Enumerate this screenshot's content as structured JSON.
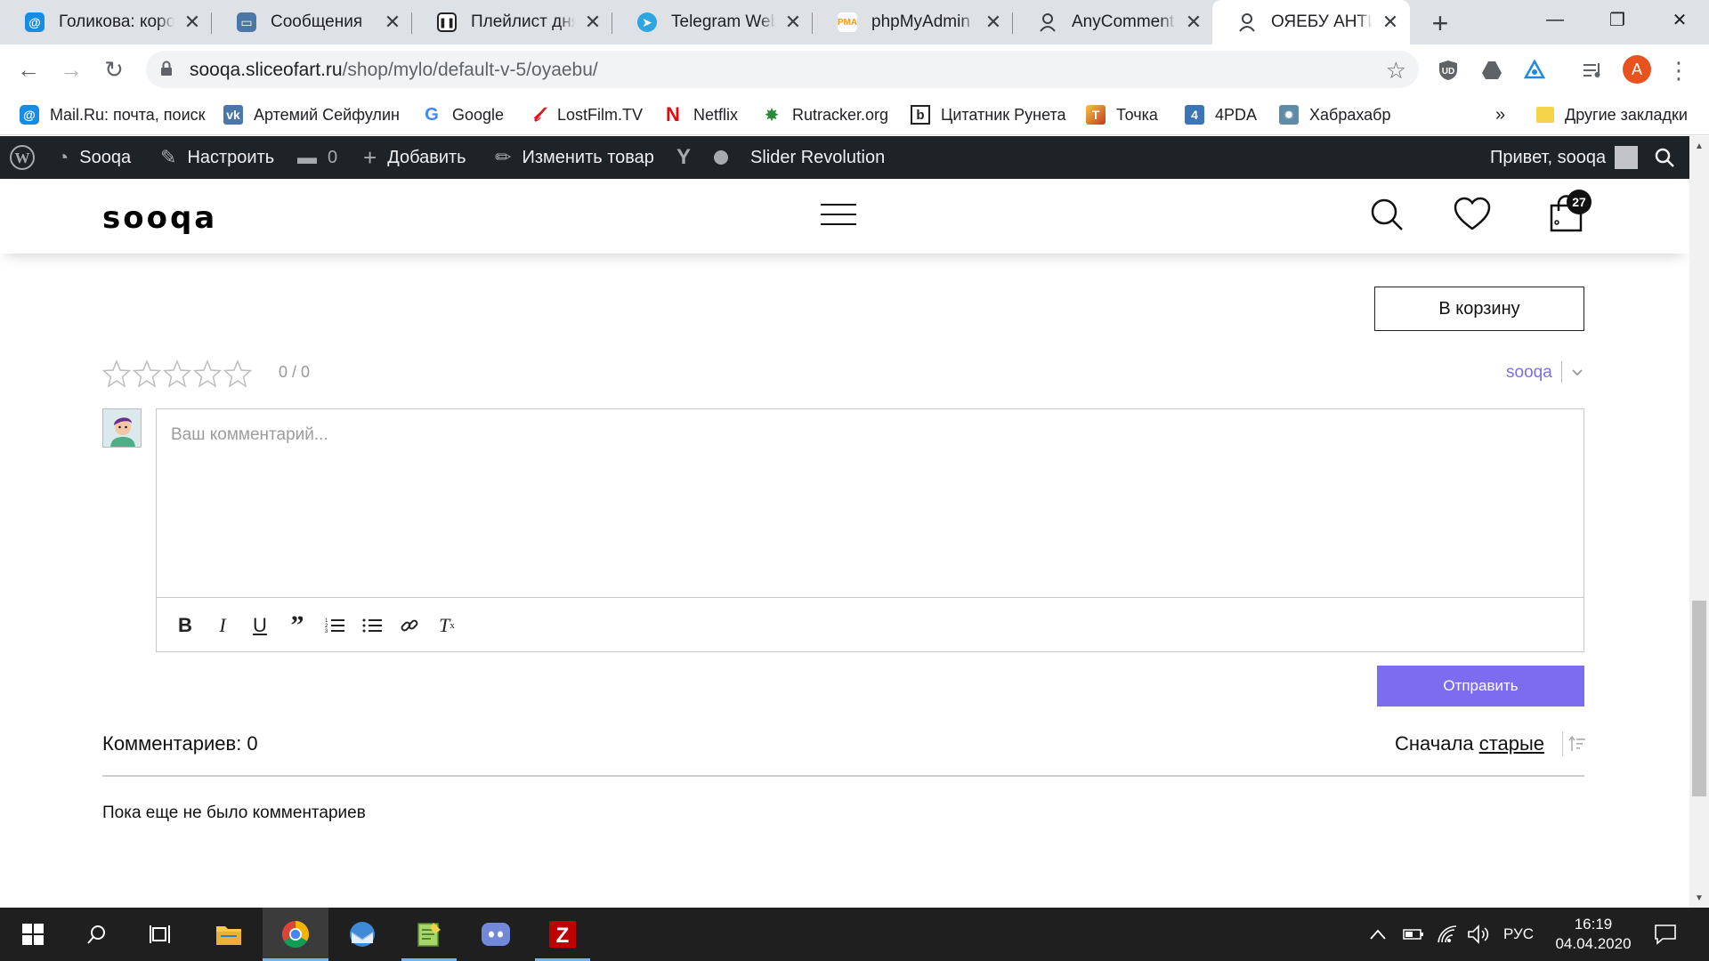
{
  "tabs": [
    {
      "title": "Голикова: коронавирус",
      "icon": "mailru-icon",
      "color": "#168de2"
    },
    {
      "title": "Сообщения",
      "icon": "vk-messages-icon",
      "color": "#4a76a8"
    },
    {
      "title": "Плейлист дня — Яндекс",
      "icon": "pause-icon",
      "color": "#222222"
    },
    {
      "title": "Telegram Web",
      "icon": "telegram-icon",
      "color": "#2ca5e0"
    },
    {
      "title": "phpMyAdmin",
      "icon": "phpmyadmin-icon",
      "color": "#f89c0e"
    },
    {
      "title": "AnyComment — плагин",
      "icon": "user-icon",
      "color": "#5f6368"
    },
    {
      "title": "ОЯЕБУ АНТИКРИЗИС",
      "icon": "user-icon",
      "color": "#5f6368"
    }
  ],
  "address": {
    "domain": "sooqa.sliceofart.ru",
    "path": "/shop/mylo/default-v-5/oyaebu/"
  },
  "profile_initial": "A",
  "bookmarks": [
    {
      "label": "Mail.Ru: почта, поиск",
      "icon": "mailru-icon",
      "color": "#168de2"
    },
    {
      "label": "Артемий Сейфулин",
      "icon": "vk-icon",
      "color": "#4a76a8"
    },
    {
      "label": "Google",
      "icon": "google-icon",
      "color": "#4285f4"
    },
    {
      "label": "LostFilm.TV",
      "icon": "lostfilm-icon",
      "color": "#d51a1a"
    },
    {
      "label": "Netflix",
      "icon": "netflix-icon",
      "color": "#e50914"
    },
    {
      "label": "Rutracker.org",
      "icon": "rutracker-icon",
      "color": "#2a8a3a"
    },
    {
      "label": "Цитатник Рунета",
      "icon": "bash-icon",
      "color": "#222222"
    },
    {
      "label": "Точка",
      "icon": "tochka-icon",
      "color": "#c23b22"
    },
    {
      "label": "4PDA",
      "icon": "4pda-icon",
      "color": "#3c74b8"
    },
    {
      "label": "Хабрахабр",
      "icon": "habr-icon",
      "color": "#5e8ba6"
    }
  ],
  "bookmarks_overflow": "»",
  "other_bookmarks": "Другие закладки",
  "adminbar": {
    "site": "Sooqa",
    "customize": "Настроить",
    "comments_count": "0",
    "add_new": "Добавить",
    "edit": "Изменить товар",
    "slider": "Slider Revolution",
    "greeting": "Привет, sooqa"
  },
  "site": {
    "logo": "sooqa",
    "cart_count": "27"
  },
  "product": {
    "add_to_cart": "В корзину"
  },
  "rating": {
    "value": "0 / 0",
    "stars_filled": 0,
    "stars_total": 5
  },
  "comments": {
    "username": "sooqa",
    "placeholder": "Ваш комментарий...",
    "submit": "Отправить",
    "count_label": "Комментариев: 0",
    "sort_prefix": "Сначала",
    "sort_link": "старые",
    "empty": "Пока еще не было комментариев"
  },
  "taskbar": {
    "language": "РУС",
    "time": "16:19",
    "date": "04.04.2020"
  },
  "colors": {
    "accent": "#7b6cf0",
    "user_link": "#7e6ee6",
    "admin_bar": "#1d2327"
  }
}
